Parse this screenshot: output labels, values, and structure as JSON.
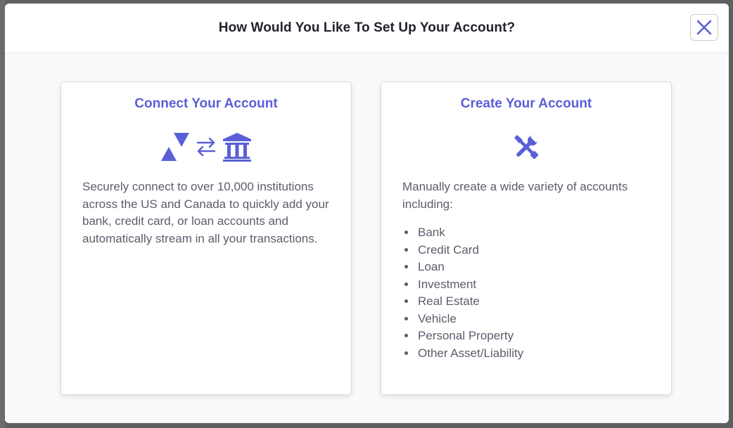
{
  "modal": {
    "title": "How Would You Like To Set Up Your Account?",
    "close_icon": "close-icon",
    "accent_color": "#5a5fd6"
  },
  "connect_card": {
    "title": "Connect Your Account",
    "icons": [
      "triangles-icon",
      "transfer-arrows-icon",
      "bank-icon"
    ],
    "description": "Securely connect to over 10,000 institutions across the US and Canada to quickly add your bank, credit card, or loan accounts and automatically stream in all your transactions."
  },
  "create_card": {
    "title": "Create Your Account",
    "icon": "tools-icon",
    "description": "Manually create a wide variety of accounts including:",
    "account_types": [
      "Bank",
      "Credit Card",
      "Loan",
      "Investment",
      "Real Estate",
      "Vehicle",
      "Personal Property",
      "Other Asset/Liability"
    ]
  }
}
